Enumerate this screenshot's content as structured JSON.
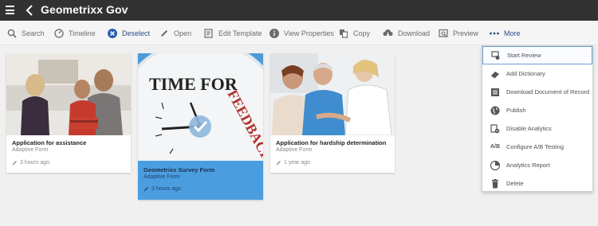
{
  "header": {
    "title": "Geometrixx Gov"
  },
  "toolbar": {
    "items": [
      {
        "label": "Search",
        "icon": "search-icon"
      },
      {
        "label": "Timeline",
        "icon": "timeline-icon"
      },
      {
        "label": "Deselect",
        "icon": "close-circle-icon"
      },
      {
        "label": "Open",
        "icon": "pencil-icon"
      },
      {
        "label": "Edit Template",
        "icon": "edit-template-icon"
      },
      {
        "label": "View Properties",
        "icon": "info-icon"
      },
      {
        "label": "Copy",
        "icon": "copy-icon"
      },
      {
        "label": "Download",
        "icon": "download-icon"
      },
      {
        "label": "Preview",
        "icon": "preview-icon"
      },
      {
        "label": "More",
        "icon": "ellipsis-icon"
      }
    ]
  },
  "cards": [
    {
      "title": "Application for assistance",
      "type": "Adaptive Form",
      "modified": "3 hours ago",
      "selected": false
    },
    {
      "title": "Geometrixx Survey Form",
      "type": "Adaptive Form",
      "modified": "3 hours ago",
      "selected": true,
      "thumb_text": "TIME FOR FEEDBACK"
    },
    {
      "title": "Application for hardship determination",
      "type": "Adaptive Form",
      "modified": "1 year ago",
      "selected": false
    }
  ],
  "menu": {
    "items": [
      {
        "label": "Start Review",
        "icon": "start-review-icon"
      },
      {
        "label": "Add Dictionary",
        "icon": "dictionary-icon"
      },
      {
        "label": "Download Document of Record",
        "icon": "document-icon"
      },
      {
        "label": "Publish",
        "icon": "globe-icon"
      },
      {
        "label": "Disable Analytics",
        "icon": "disable-analytics-icon"
      },
      {
        "label": "Configure A/B Testing",
        "icon": "ab-testing-icon"
      },
      {
        "label": "Analytics Report",
        "icon": "analytics-report-icon"
      },
      {
        "label": "Delete",
        "icon": "trash-icon"
      }
    ],
    "ab_icon_text": "A/B"
  },
  "colors": {
    "header_bg": "#323232",
    "selection": "#4a9ee0",
    "accent": "#2d4a8a"
  }
}
